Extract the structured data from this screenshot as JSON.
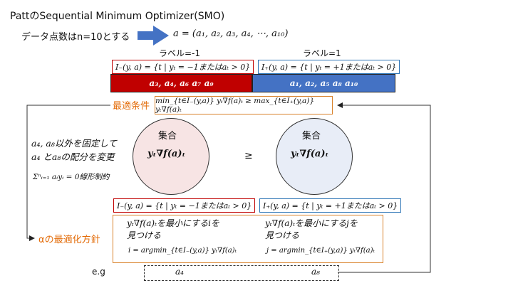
{
  "title": "PattのSequential Minimum Optimizer(SMO)",
  "note": "データ点数はn=10とする",
  "vector": "a = (a₁, a₂, a₃, a₄, ⋯, a₁₀)",
  "label_neg": "ラベル=-1",
  "label_pos": "ラベル=1",
  "set_neg": "I₋(y, a) = {t | yₜ = −1またはaₜ > 0}",
  "set_pos": "I₊(y, a) = {t | yₜ = +1またはaₜ > 0}",
  "bar_neg": "a₃, a₄, a₆  a₇  a₉",
  "bar_pos": "a₁, a₂, a₅  a₈  a₁₀",
  "optimal_condition_label": "最適条件",
  "optimal_condition": "min_{t∈I₋(y,a)} yₜ∇f(a)ₜ ≥ max_{t∈I₊(y,a)} yₜ∇f(a)ₜ",
  "left_circle_title": "集合",
  "left_circle_expr": "yₜ∇f(a)ₜ",
  "right_circle_title": "集合",
  "right_circle_expr": "yₜ∇f(a)ₜ",
  "geq": "≥",
  "fix_line1": "a₄, a₈以外を固定して",
  "fix_line2": "a₄ とa₈の配分を変更",
  "constraint": "Σⁿᵢ₌₁ aᵢyᵢ = 0線形制約",
  "policy_label": "αの最適化方針",
  "min_text_1": "yₜ∇f(a)ₜを最小にするiを",
  "min_text_2": "見つける",
  "max_text_1": "yₜ∇f(a)ₜを最小にするjを",
  "max_text_2": "見つける",
  "i_formula": "i = argmin_{t∈I₋(y,a)} yₜ∇f(a)ₜ",
  "j_formula": "j = argmin_{t∈I₊(y,a)} yₜ∇f(a)ₜ",
  "eg_label": "e.g",
  "eg_left": "a₄",
  "eg_right": "a₈",
  "colors": {
    "red_bar": "#c00000",
    "blue_bar": "#4472c4",
    "orange": "#e36c09",
    "left_circle_fill": "#f7e4e4",
    "right_circle_fill": "#e8edf7"
  }
}
